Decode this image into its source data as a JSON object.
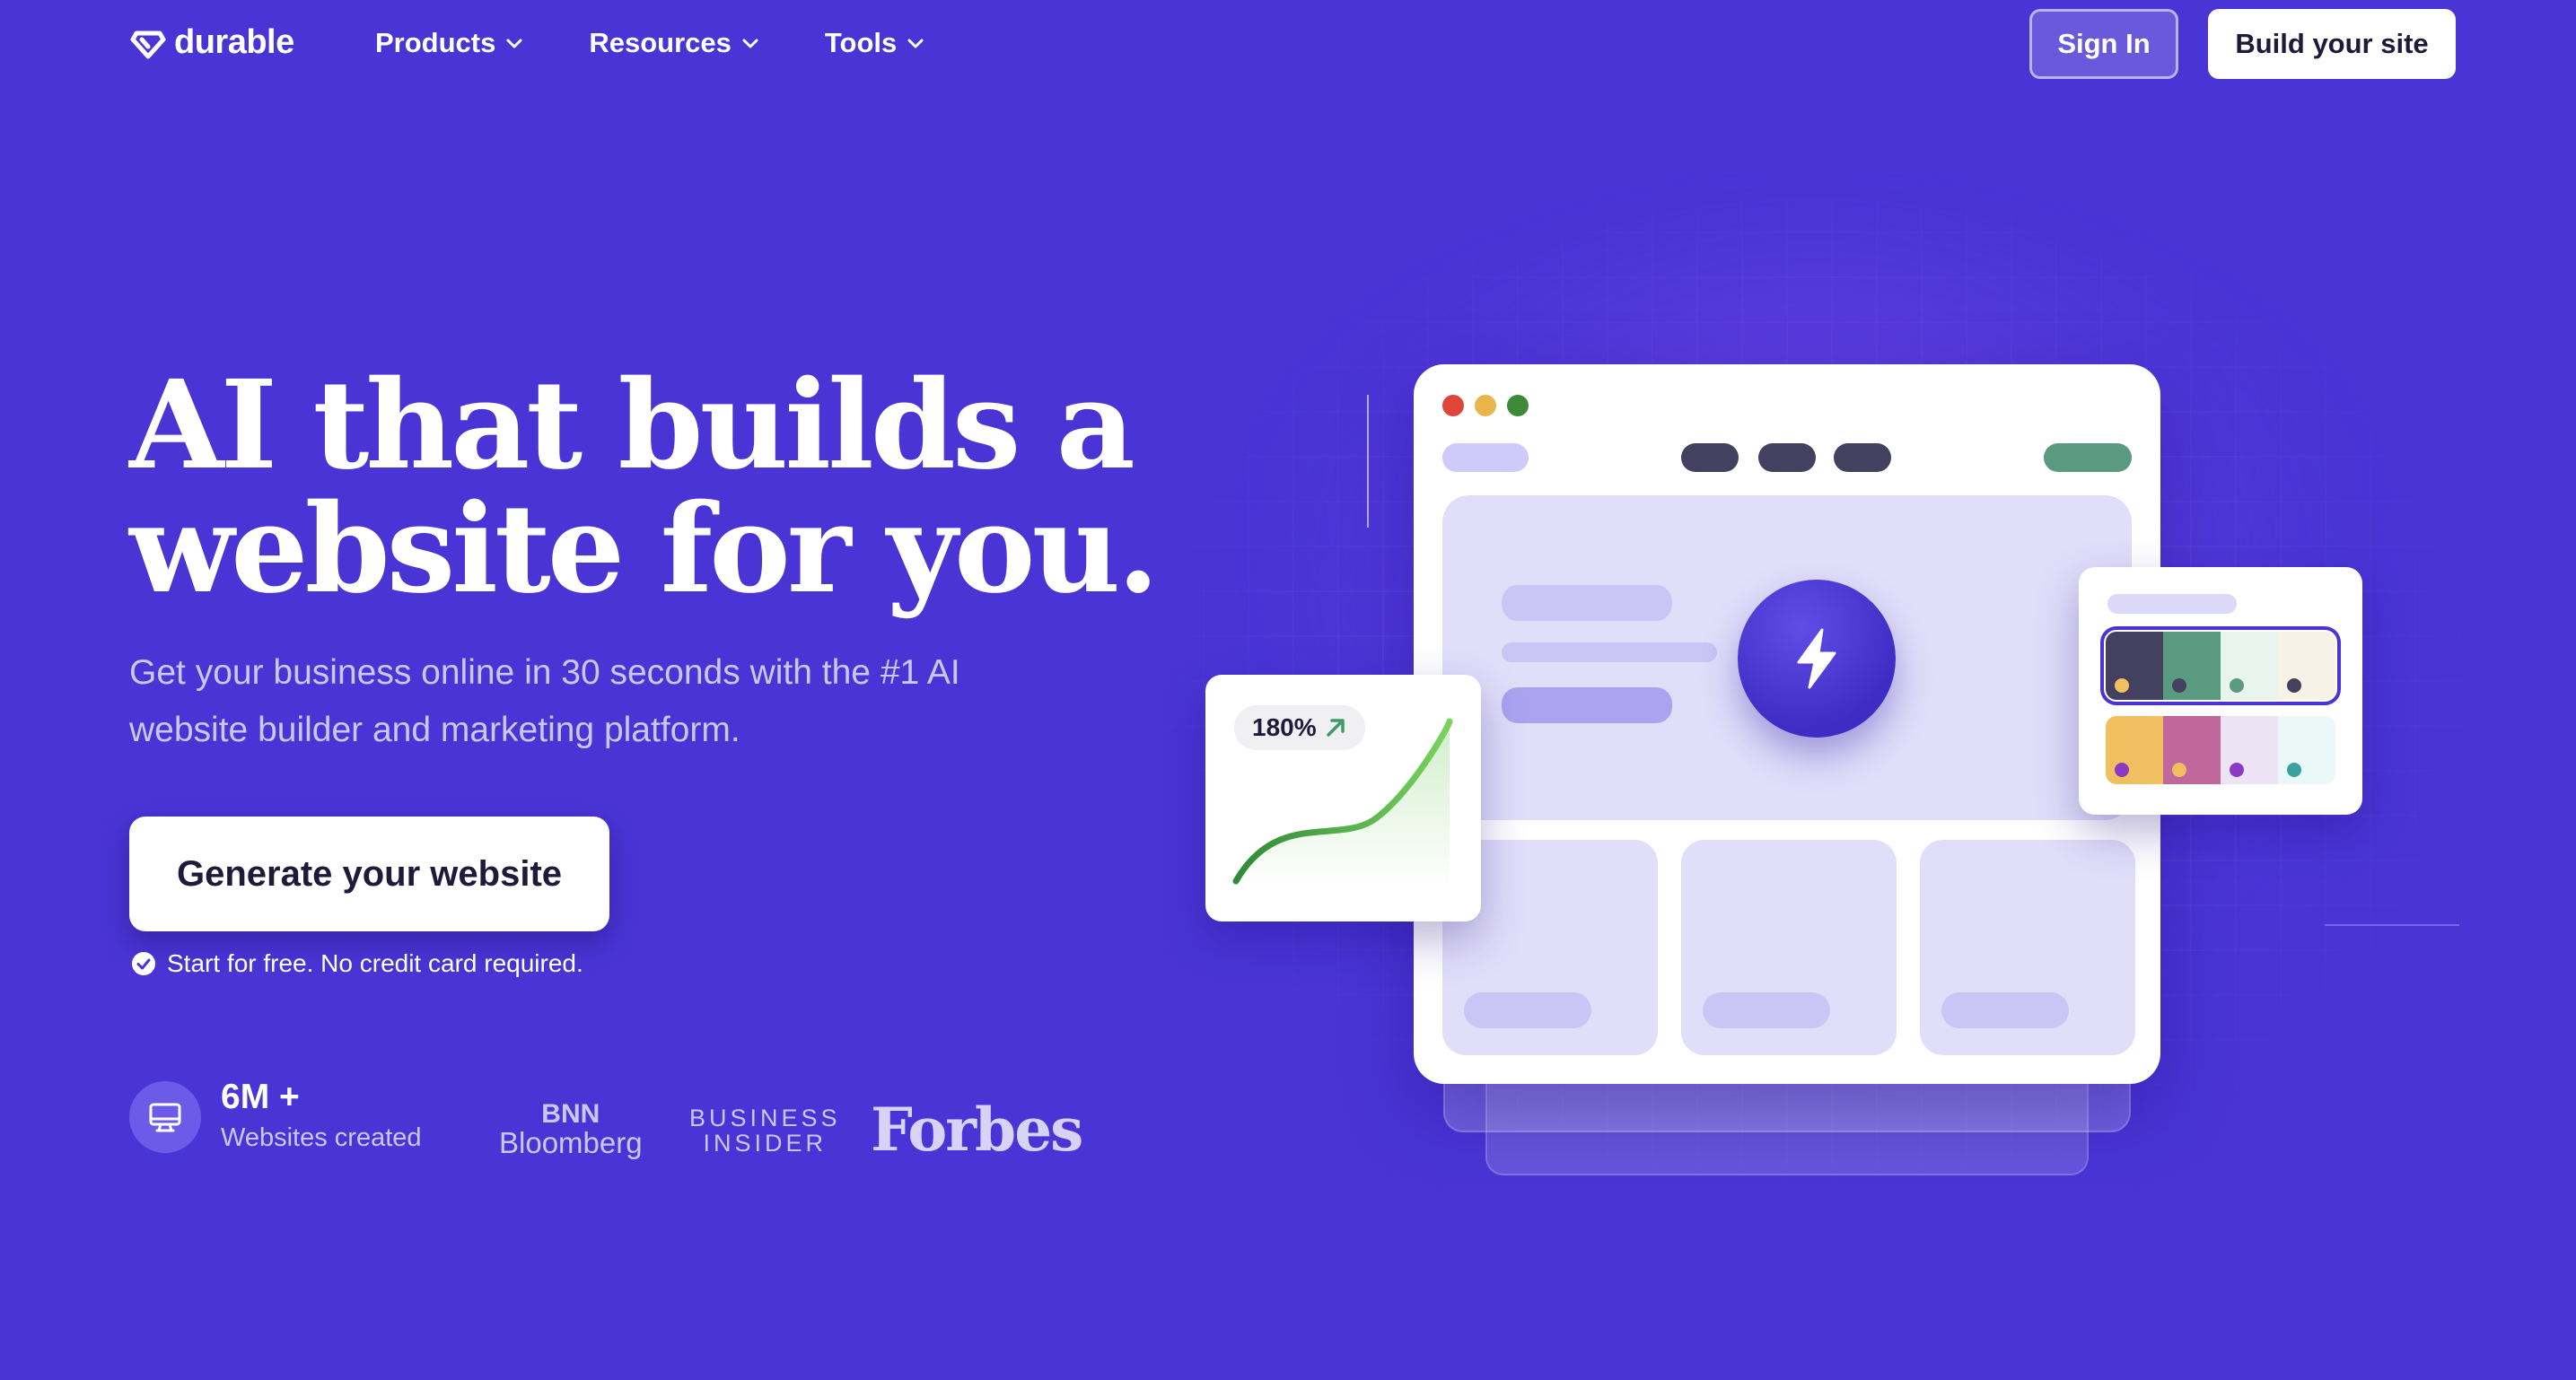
{
  "nav": {
    "logo_text": "durable",
    "menu": [
      {
        "label": "Products"
      },
      {
        "label": "Resources"
      },
      {
        "label": "Tools"
      }
    ],
    "sign_in": "Sign In",
    "build_site": "Build your site"
  },
  "hero": {
    "title_line1": "AI that builds a",
    "title_line2": "website for you.",
    "subtitle_line1": "Get your business online in 30 seconds with the #1 AI",
    "subtitle_line2": "website builder and marketing platform.",
    "cta": "Generate your website",
    "note": "Start for free. No credit card required."
  },
  "stat": {
    "value": "6M +",
    "label": "Websites created"
  },
  "press": {
    "bnn_line1": "BNN",
    "bnn_line2": "Bloomberg",
    "bi_line1": "BUSINESS",
    "bi_line2": "INSIDER",
    "forbes": "Forbes"
  },
  "illustration": {
    "growth_badge": "180%",
    "colors": {
      "background": "#4a34d6",
      "panel": "#e1defa",
      "accent_green": "#5a9a80",
      "dark_pill": "#434060"
    },
    "palettes": [
      [
        "#444160",
        "#5a9a80",
        "#eaf4ee",
        "#f7f2e6"
      ],
      [
        "#f0c060",
        "#c0689c",
        "#ece4f4",
        "#eaf8f8"
      ]
    ]
  }
}
